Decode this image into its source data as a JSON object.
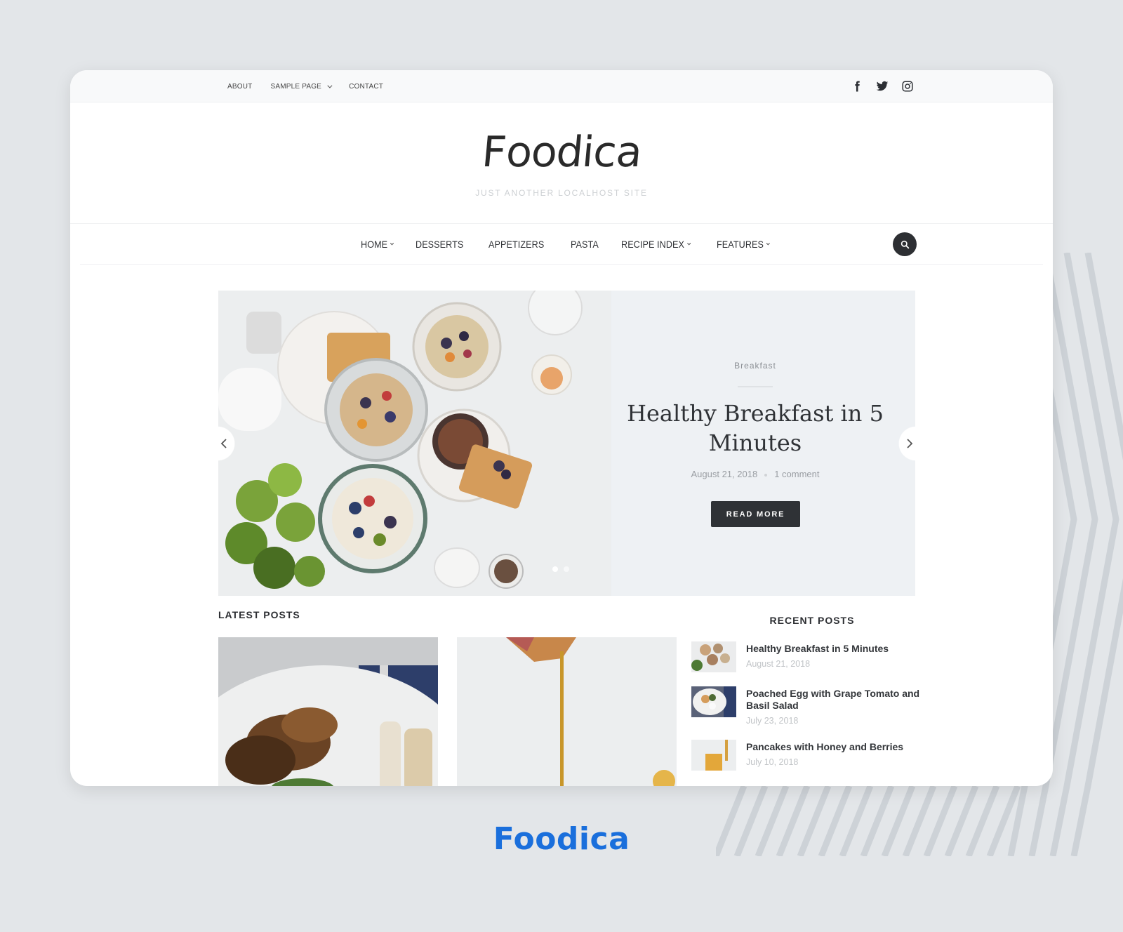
{
  "topbar": {
    "nav": [
      {
        "label": "ABOUT",
        "has_dropdown": false
      },
      {
        "label": "SAMPLE PAGE",
        "has_dropdown": true
      },
      {
        "label": "CONTACT",
        "has_dropdown": false
      }
    ],
    "social": [
      "facebook-icon",
      "twitter-icon",
      "instagram-icon"
    ]
  },
  "header": {
    "logo": "Foodica",
    "tagline": "JUST ANOTHER LOCALHOST SITE"
  },
  "main_nav": {
    "items": [
      {
        "label": "HOME",
        "has_dropdown": true
      },
      {
        "label": "DESSERTS",
        "has_dropdown": false
      },
      {
        "label": "APPETIZERS",
        "has_dropdown": false
      },
      {
        "label": "PASTA",
        "has_dropdown": false
      },
      {
        "label": "RECIPE INDEX",
        "has_dropdown": true
      },
      {
        "label": "FEATURES",
        "has_dropdown": true
      }
    ],
    "search_icon": "search-icon"
  },
  "hero": {
    "category": "Breakfast",
    "title": "Healthy Breakfast in 5 Minutes",
    "date": "August 21, 2018",
    "comments": "1 comment",
    "button": "READ MORE",
    "slides_total": 2,
    "active_slide": 1
  },
  "latest_posts": {
    "title": "LATEST POSTS"
  },
  "recent_posts": {
    "title": "RECENT POSTS",
    "items": [
      {
        "title": "Healthy Breakfast in 5 Minutes",
        "date": "August 21, 2018"
      },
      {
        "title": "Poached Egg with Grape Tomato and Basil Salad",
        "date": "July 23, 2018"
      },
      {
        "title": "Pancakes with Honey and Berries",
        "date": "July 10, 2018"
      }
    ]
  },
  "brand": {
    "label": "Foodica",
    "color": "#1a6fdc"
  }
}
